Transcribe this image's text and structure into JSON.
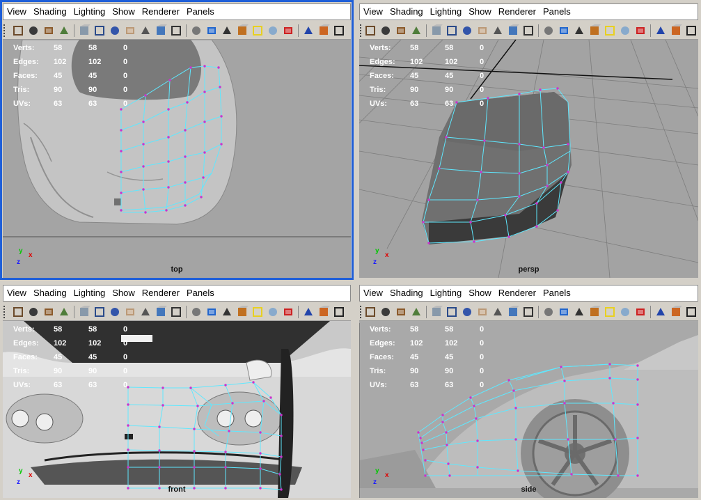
{
  "menu": [
    "View",
    "Shading",
    "Lighting",
    "Show",
    "Renderer",
    "Panels"
  ],
  "hud": {
    "labels": [
      "Verts:",
      "Edges:",
      "Faces:",
      "Tris:",
      "UVs:"
    ],
    "rows": [
      [
        "58",
        "58",
        "0"
      ],
      [
        "102",
        "102",
        "0"
      ],
      [
        "45",
        "45",
        "0"
      ],
      [
        "90",
        "90",
        "0"
      ],
      [
        "63",
        "63",
        "0"
      ]
    ]
  },
  "views": {
    "top": {
      "label": "top",
      "active": true
    },
    "persp": {
      "label": "persp",
      "active": false
    },
    "front": {
      "label": "front",
      "active": false
    },
    "side": {
      "label": "side",
      "active": false
    }
  },
  "axis": {
    "y": "y",
    "x": "x",
    "z": "z"
  },
  "toolbar_icons": [
    "select-camera-icon",
    "camera-attributes-icon",
    "bookmarks-icon",
    "image-plane-icon",
    "grid-icon",
    "film-gate-icon",
    "resolution-gate-icon",
    "gate-mask-icon",
    "field-chart-icon",
    "safe-action-icon",
    "safe-title-icon",
    "wireframe-icon",
    "smooth-shade-icon",
    "flat-shade-icon",
    "texture-icon",
    "use-lights-icon",
    "shadows-icon",
    "xray-icon",
    "isolate-select-icon",
    "frame-selection-icon",
    "frame-all-icon"
  ],
  "colors": {
    "active_border": "#1f5fd8",
    "wire": "#5fe8ff",
    "vertex": "#cc33cc",
    "viewport_bg": "#a0a0a0"
  }
}
